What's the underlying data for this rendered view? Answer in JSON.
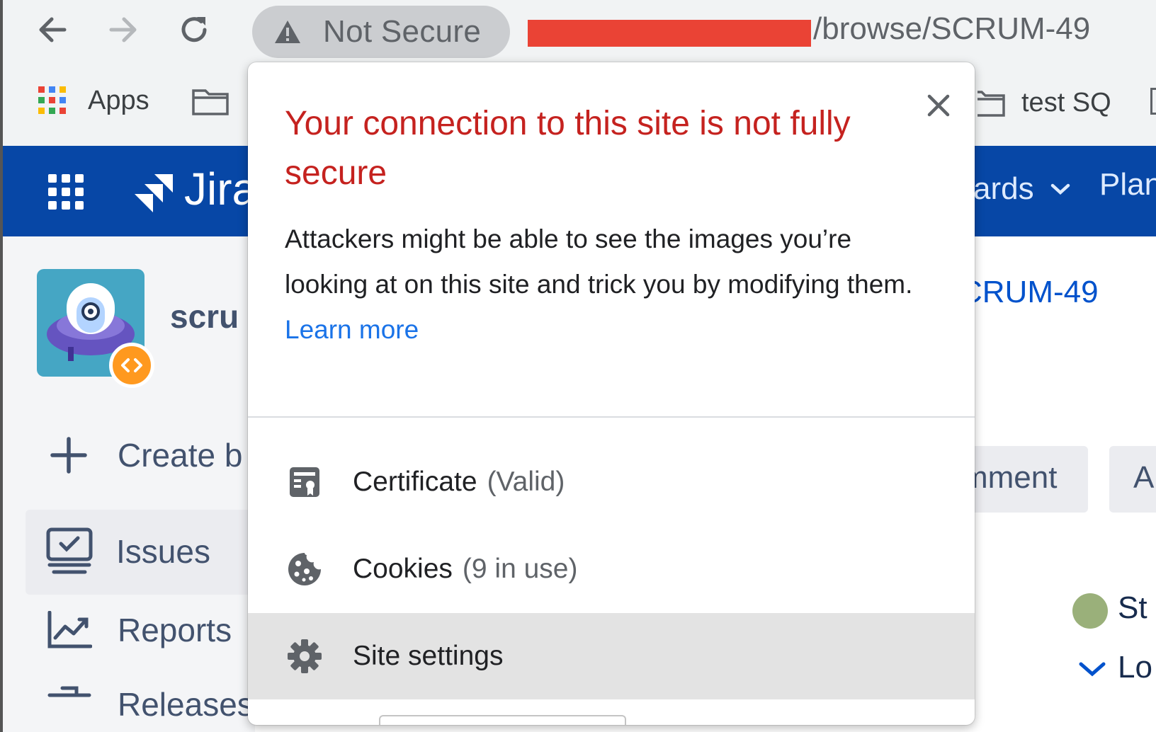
{
  "browser": {
    "security_label": "Not Secure",
    "url_path": "/browse/SCRUM-49",
    "bookmarks": {
      "apps": "Apps",
      "test_sq": "test SQ"
    }
  },
  "jira": {
    "logo_text": "Jira",
    "nav_boards": "ards",
    "nav_plans": "Plan",
    "project_name": "scru",
    "breadcrumb_issue": "CRUM-49",
    "sidebar": {
      "create": "Create b",
      "issues": "Issues",
      "reports": "Reports",
      "releases": "Releases"
    },
    "comment_button": "mment",
    "a_button": "A",
    "status_partial": "St",
    "lo_partial": "Lo"
  },
  "popup": {
    "title": "Your connection to this site is not fully secure",
    "body": "Attackers might be able to see the images you’re looking at on this site and trick you by modifying them.",
    "learn_more": "Learn more",
    "certificate_label": "Certificate",
    "certificate_status": "(Valid)",
    "cookies_label": "Cookies",
    "cookies_status": "(9 in use)",
    "site_settings_label": "Site settings"
  },
  "colors": {
    "warning_red": "#c5221f",
    "link_blue": "#1a73e8",
    "jira_blue": "#0747a6",
    "redaction": "#ea4335"
  }
}
